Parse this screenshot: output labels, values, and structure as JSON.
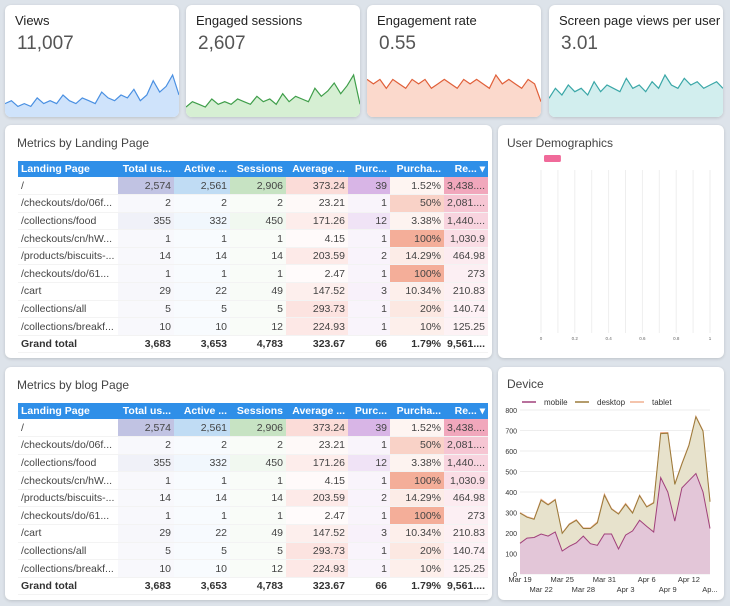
{
  "kpis": [
    {
      "title": "Views",
      "value": "11,007",
      "color": "#4a90e2",
      "fill": "#cfe3fb",
      "spark": [
        4,
        5,
        3,
        4,
        3,
        6,
        4,
        5,
        4,
        7,
        5,
        4,
        6,
        5,
        4,
        8,
        6,
        5,
        7,
        6,
        9,
        5,
        7,
        12,
        8,
        10,
        14,
        7
      ]
    },
    {
      "title": "Engaged sessions",
      "value": "2,607",
      "color": "#3f9e4a",
      "fill": "#d6efd3",
      "spark": [
        3,
        5,
        4,
        3,
        6,
        4,
        5,
        4,
        6,
        5,
        4,
        7,
        5,
        6,
        4,
        8,
        5,
        7,
        6,
        5,
        10,
        7,
        9,
        12,
        8,
        11,
        15,
        4
      ]
    },
    {
      "title": "Engagement rate",
      "value": "0.55",
      "color": "#e0603a",
      "fill": "#fbd9cc",
      "spark": [
        8,
        7,
        8,
        6,
        8,
        7,
        6,
        8,
        7,
        8,
        6,
        7,
        8,
        7,
        6,
        8,
        7,
        8,
        7,
        6,
        9,
        7,
        8,
        7,
        6,
        8,
        7,
        3
      ]
    },
    {
      "title": "Screen page views per user",
      "value": "3.01",
      "color": "#3aa7a7",
      "fill": "#d2eeee",
      "spark": [
        5,
        8,
        6,
        9,
        7,
        8,
        6,
        10,
        7,
        9,
        8,
        7,
        11,
        8,
        9,
        7,
        10,
        8,
        12,
        9,
        8,
        11,
        9,
        10,
        8,
        9,
        10,
        8
      ]
    }
  ],
  "tables": [
    {
      "title": "Metrics by Landing Page"
    },
    {
      "title": "Metrics by blog Page"
    }
  ],
  "table": {
    "headers": [
      "Landing Page",
      "Total us...",
      "Active ...",
      "Sessions",
      "Average ...",
      "Purc...",
      "Purcha...",
      "Re... ▾"
    ],
    "rows": [
      [
        "/",
        "2,574",
        "2,561",
        "2,906",
        "373.24",
        "39",
        "1.52%",
        "3,438...."
      ],
      [
        "/checkouts/do/06f...",
        "2",
        "2",
        "2",
        "23.21",
        "1",
        "50%",
        "2,081...."
      ],
      [
        "/collections/food",
        "355",
        "332",
        "450",
        "171.26",
        "12",
        "3.38%",
        "1,440...."
      ],
      [
        "/checkouts/cn/hW...",
        "1",
        "1",
        "1",
        "4.15",
        "1",
        "100%",
        "1,030.9"
      ],
      [
        "/products/biscuits-...",
        "14",
        "14",
        "14",
        "203.59",
        "2",
        "14.29%",
        "464.98"
      ],
      [
        "/checkouts/do/61...",
        "1",
        "1",
        "1",
        "2.47",
        "1",
        "100%",
        "273"
      ],
      [
        "/cart",
        "29",
        "22",
        "49",
        "147.52",
        "3",
        "10.34%",
        "210.83"
      ],
      [
        "/collections/all",
        "5",
        "5",
        "5",
        "293.73",
        "1",
        "20%",
        "140.74"
      ],
      [
        "/collections/breakf...",
        "10",
        "10",
        "12",
        "224.93",
        "1",
        "10%",
        "125.25"
      ]
    ],
    "total": [
      "Grand total",
      "3,683",
      "3,653",
      "4,783",
      "323.67",
      "66",
      "1.79%",
      "9,561...."
    ]
  },
  "demographics": {
    "title": "User Demographics",
    "bar_color": "#f06a9a",
    "bar_value": 0.1,
    "ticks": [
      "0",
      "0.2",
      "0.4",
      "0.6",
      "0.8",
      "1"
    ]
  },
  "chart_data": {
    "type": "area",
    "title": "Device",
    "x_labels_row1": [
      "Mar 19",
      "Mar 25",
      "Mar 31",
      "Apr 6",
      "Apr 12"
    ],
    "x_labels_row2": [
      "Mar 22",
      "Mar 28",
      "Apr 3",
      "Apr 9",
      "Ap..."
    ],
    "ylim": [
      0,
      800
    ],
    "yticks": [
      "0",
      "100",
      "200",
      "300",
      "400",
      "500",
      "600",
      "700",
      "800"
    ],
    "x": [
      "Mar 19",
      "Mar 20",
      "Mar 21",
      "Mar 22",
      "Mar 23",
      "Mar 24",
      "Mar 25",
      "Mar 26",
      "Mar 27",
      "Mar 28",
      "Mar 29",
      "Mar 30",
      "Mar 31",
      "Apr 1",
      "Apr 2",
      "Apr 3",
      "Apr 4",
      "Apr 5",
      "Apr 6",
      "Apr 7",
      "Apr 8",
      "Apr 9",
      "Apr 10",
      "Apr 11",
      "Apr 12",
      "Apr 13",
      "Apr 14",
      "Apr 15"
    ],
    "stacked": true,
    "series": [
      {
        "name": "mobile",
        "color": "#a0407a",
        "fill": "#e3c6d8",
        "values": [
          150,
          175,
          178,
          195,
          185,
          205,
          112,
          135,
          152,
          185,
          148,
          140,
          195,
          195,
          122,
          190,
          210,
          262,
          232,
          205,
          470,
          400,
          258,
          420,
          455,
          490,
          400,
          222
        ]
      },
      {
        "name": "desktop",
        "color": "#9a7a3a",
        "fill": "#e7e2cc",
        "values": [
          147,
          102,
          89,
          165,
          152,
          157,
          86,
          107,
          110,
          37,
          74,
          110,
          190,
          122,
          170,
          150,
          87,
          120,
          95,
          142,
          215,
          287,
          179,
          117,
          172,
          277,
          297,
          130
        ]
      },
      {
        "name": "tablet",
        "color": "#f0b090",
        "fill": "#f8e0d0",
        "values": [
          3,
          3,
          3,
          5,
          3,
          3,
          2,
          3,
          3,
          3,
          3,
          5,
          5,
          3,
          3,
          5,
          3,
          3,
          3,
          3,
          5,
          3,
          3,
          3,
          3,
          3,
          3,
          3
        ]
      }
    ],
    "legend": "top"
  }
}
